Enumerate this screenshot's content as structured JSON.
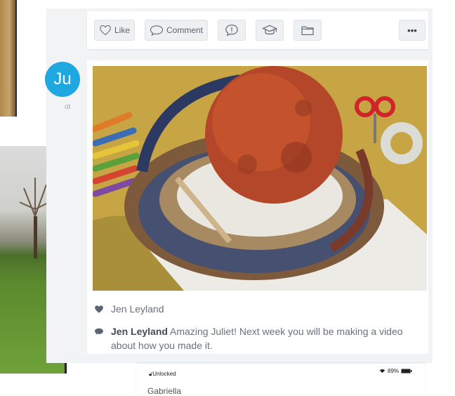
{
  "toolbar": {
    "like_label": "Like",
    "comment_label": "Comment",
    "more_label": "•••",
    "icons": [
      "heart-icon",
      "comment-icon",
      "speech-badge-icon",
      "graduation-cap-icon",
      "folder-icon",
      "more-icon"
    ]
  },
  "author": {
    "avatar_initials": "Ju",
    "avatar_color": "#1fa7e0",
    "caption": "ot"
  },
  "post": {
    "like_name": "Jen Leyland",
    "comment_name": "Jen Leyland",
    "comment_text": "Amazing Juliet! Next week you will be making a video",
    "comment_text_2": "about how you made it."
  },
  "device": {
    "lock_status": "Unlocked",
    "battery": "89%",
    "contact": "Gabriella"
  }
}
